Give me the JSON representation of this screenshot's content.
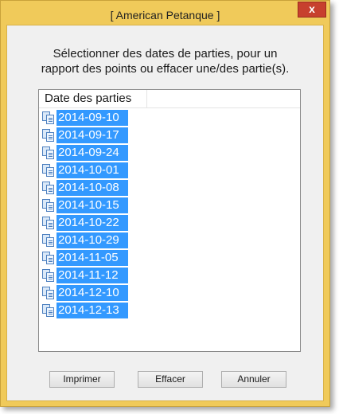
{
  "window": {
    "title": "[ American Petanque ]",
    "close_glyph": "x"
  },
  "instructions": {
    "line1": "Sélectionner des dates de parties, pour un",
    "line2": "rapport des points ou effacer une/des partie(s)."
  },
  "list": {
    "column_header": "Date des parties",
    "row_icon": "document-copy-icon",
    "selected_color": "#3399ff",
    "rows": [
      "2014-09-10",
      "2014-09-17",
      "2014-09-24",
      "2014-10-01",
      "2014-10-08",
      "2014-10-15",
      "2014-10-22",
      "2014-10-29",
      "2014-11-05",
      "2014-11-12",
      "2014-12-10",
      "2014-12-13"
    ]
  },
  "buttons": {
    "print": "Imprimer",
    "delete": "Effacer",
    "cancel": "Annuler"
  },
  "colors": {
    "frame": "#f0ca5a",
    "close_button": "#c7402e"
  }
}
